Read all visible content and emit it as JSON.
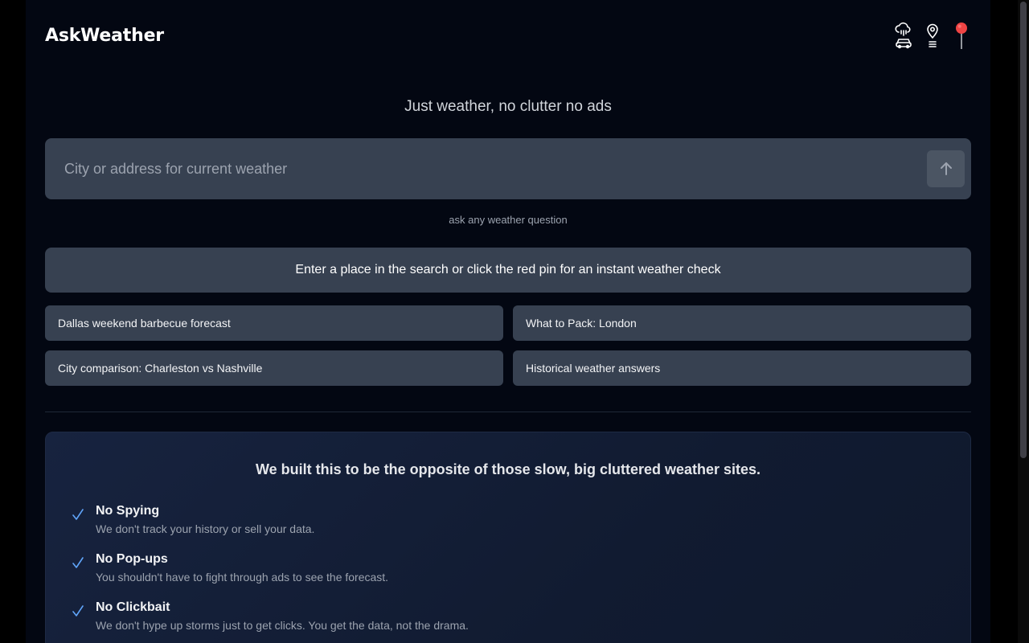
{
  "app": {
    "title": "AskWeather"
  },
  "header": {
    "icons": [
      "cloud-rain-car-icon",
      "map-pin-list-icon",
      "red-pin-icon"
    ],
    "accent_pin_color": "#ef4444"
  },
  "tagline": "Just weather, no clutter no ads",
  "search": {
    "placeholder": "City or address for current weather",
    "value": ""
  },
  "hint": "ask any weather question",
  "banner": "Enter a place in the search or click the red pin for an instant weather check",
  "suggestions": [
    "Dallas weekend barbecue forecast",
    "What to Pack: London",
    "City comparison: Charleston vs Nashville",
    "Historical weather answers"
  ],
  "about": {
    "heading": "We built this to be the opposite of those slow, big cluttered weather sites.",
    "features": [
      {
        "title": "No Spying",
        "desc": "We don't track your history or sell your data."
      },
      {
        "title": "No Pop-ups",
        "desc": "You shouldn't have to fight through ads to see the forecast."
      },
      {
        "title": "No Clickbait",
        "desc": "We don't hype up storms just to get clicks. You get the data, not the drama."
      }
    ]
  },
  "colors": {
    "background": "#030712",
    "panel": "#374151",
    "check": "#60a5fa"
  }
}
